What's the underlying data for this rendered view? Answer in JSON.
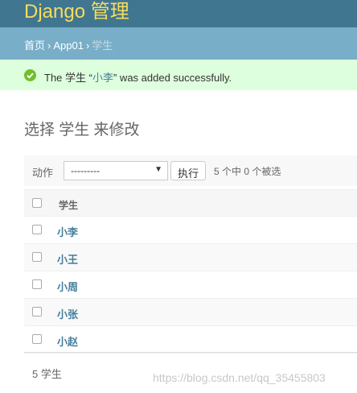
{
  "header": {
    "brand": "Django 管理"
  },
  "breadcrumbs": {
    "home": "首页",
    "sep": "›",
    "app": "App01",
    "current": "学生"
  },
  "message": {
    "prefix": "The 学生 “",
    "object": "小李",
    "suffix": "” was added successfully."
  },
  "page": {
    "title": "选择 学生 来修改"
  },
  "actions": {
    "label": "动作",
    "selected": "---------",
    "go": "执行",
    "counter": "5 个中 0 个被选"
  },
  "table": {
    "header": "学生",
    "rows": [
      "小李",
      "小王",
      "小周",
      "小张",
      "小赵"
    ]
  },
  "paginator": {
    "text": "5 学生"
  },
  "watermark": "https://blog.csdn.net/qq_35455803",
  "colors": {
    "header": "#417690",
    "brand": "#f5dd5d",
    "breadcrumbs": "#79aec8",
    "success_bg": "#dddddd",
    "link": "#447e9b"
  }
}
